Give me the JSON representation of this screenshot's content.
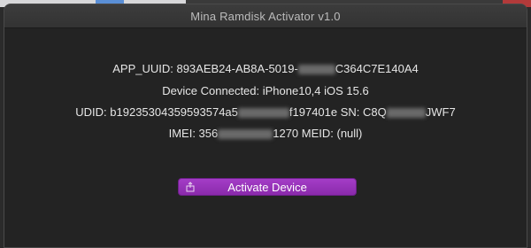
{
  "window": {
    "title": "Mina Ramdisk Activator v1.0"
  },
  "info": {
    "app_uuid_prefix": "APP_UUID: 893AEB24-AB8A-5019-",
    "app_uuid_suffix": "C364C7E140A4",
    "device_connected": "Device Connected: iPhone10,4 iOS 15.6",
    "udid_prefix": "UDID: b19235304359593574a5",
    "udid_middle": "f197401e SN: C8Q",
    "udid_suffix": "JWF7",
    "imei_prefix": "IMEI: 356",
    "imei_suffix": "1270 MEID: (null)"
  },
  "actions": {
    "activate_label": "Activate Device",
    "activate_icon": "share-icon"
  },
  "colors": {
    "button": "#9b35bd",
    "background": "#232323",
    "text": "#e6e6e6"
  }
}
